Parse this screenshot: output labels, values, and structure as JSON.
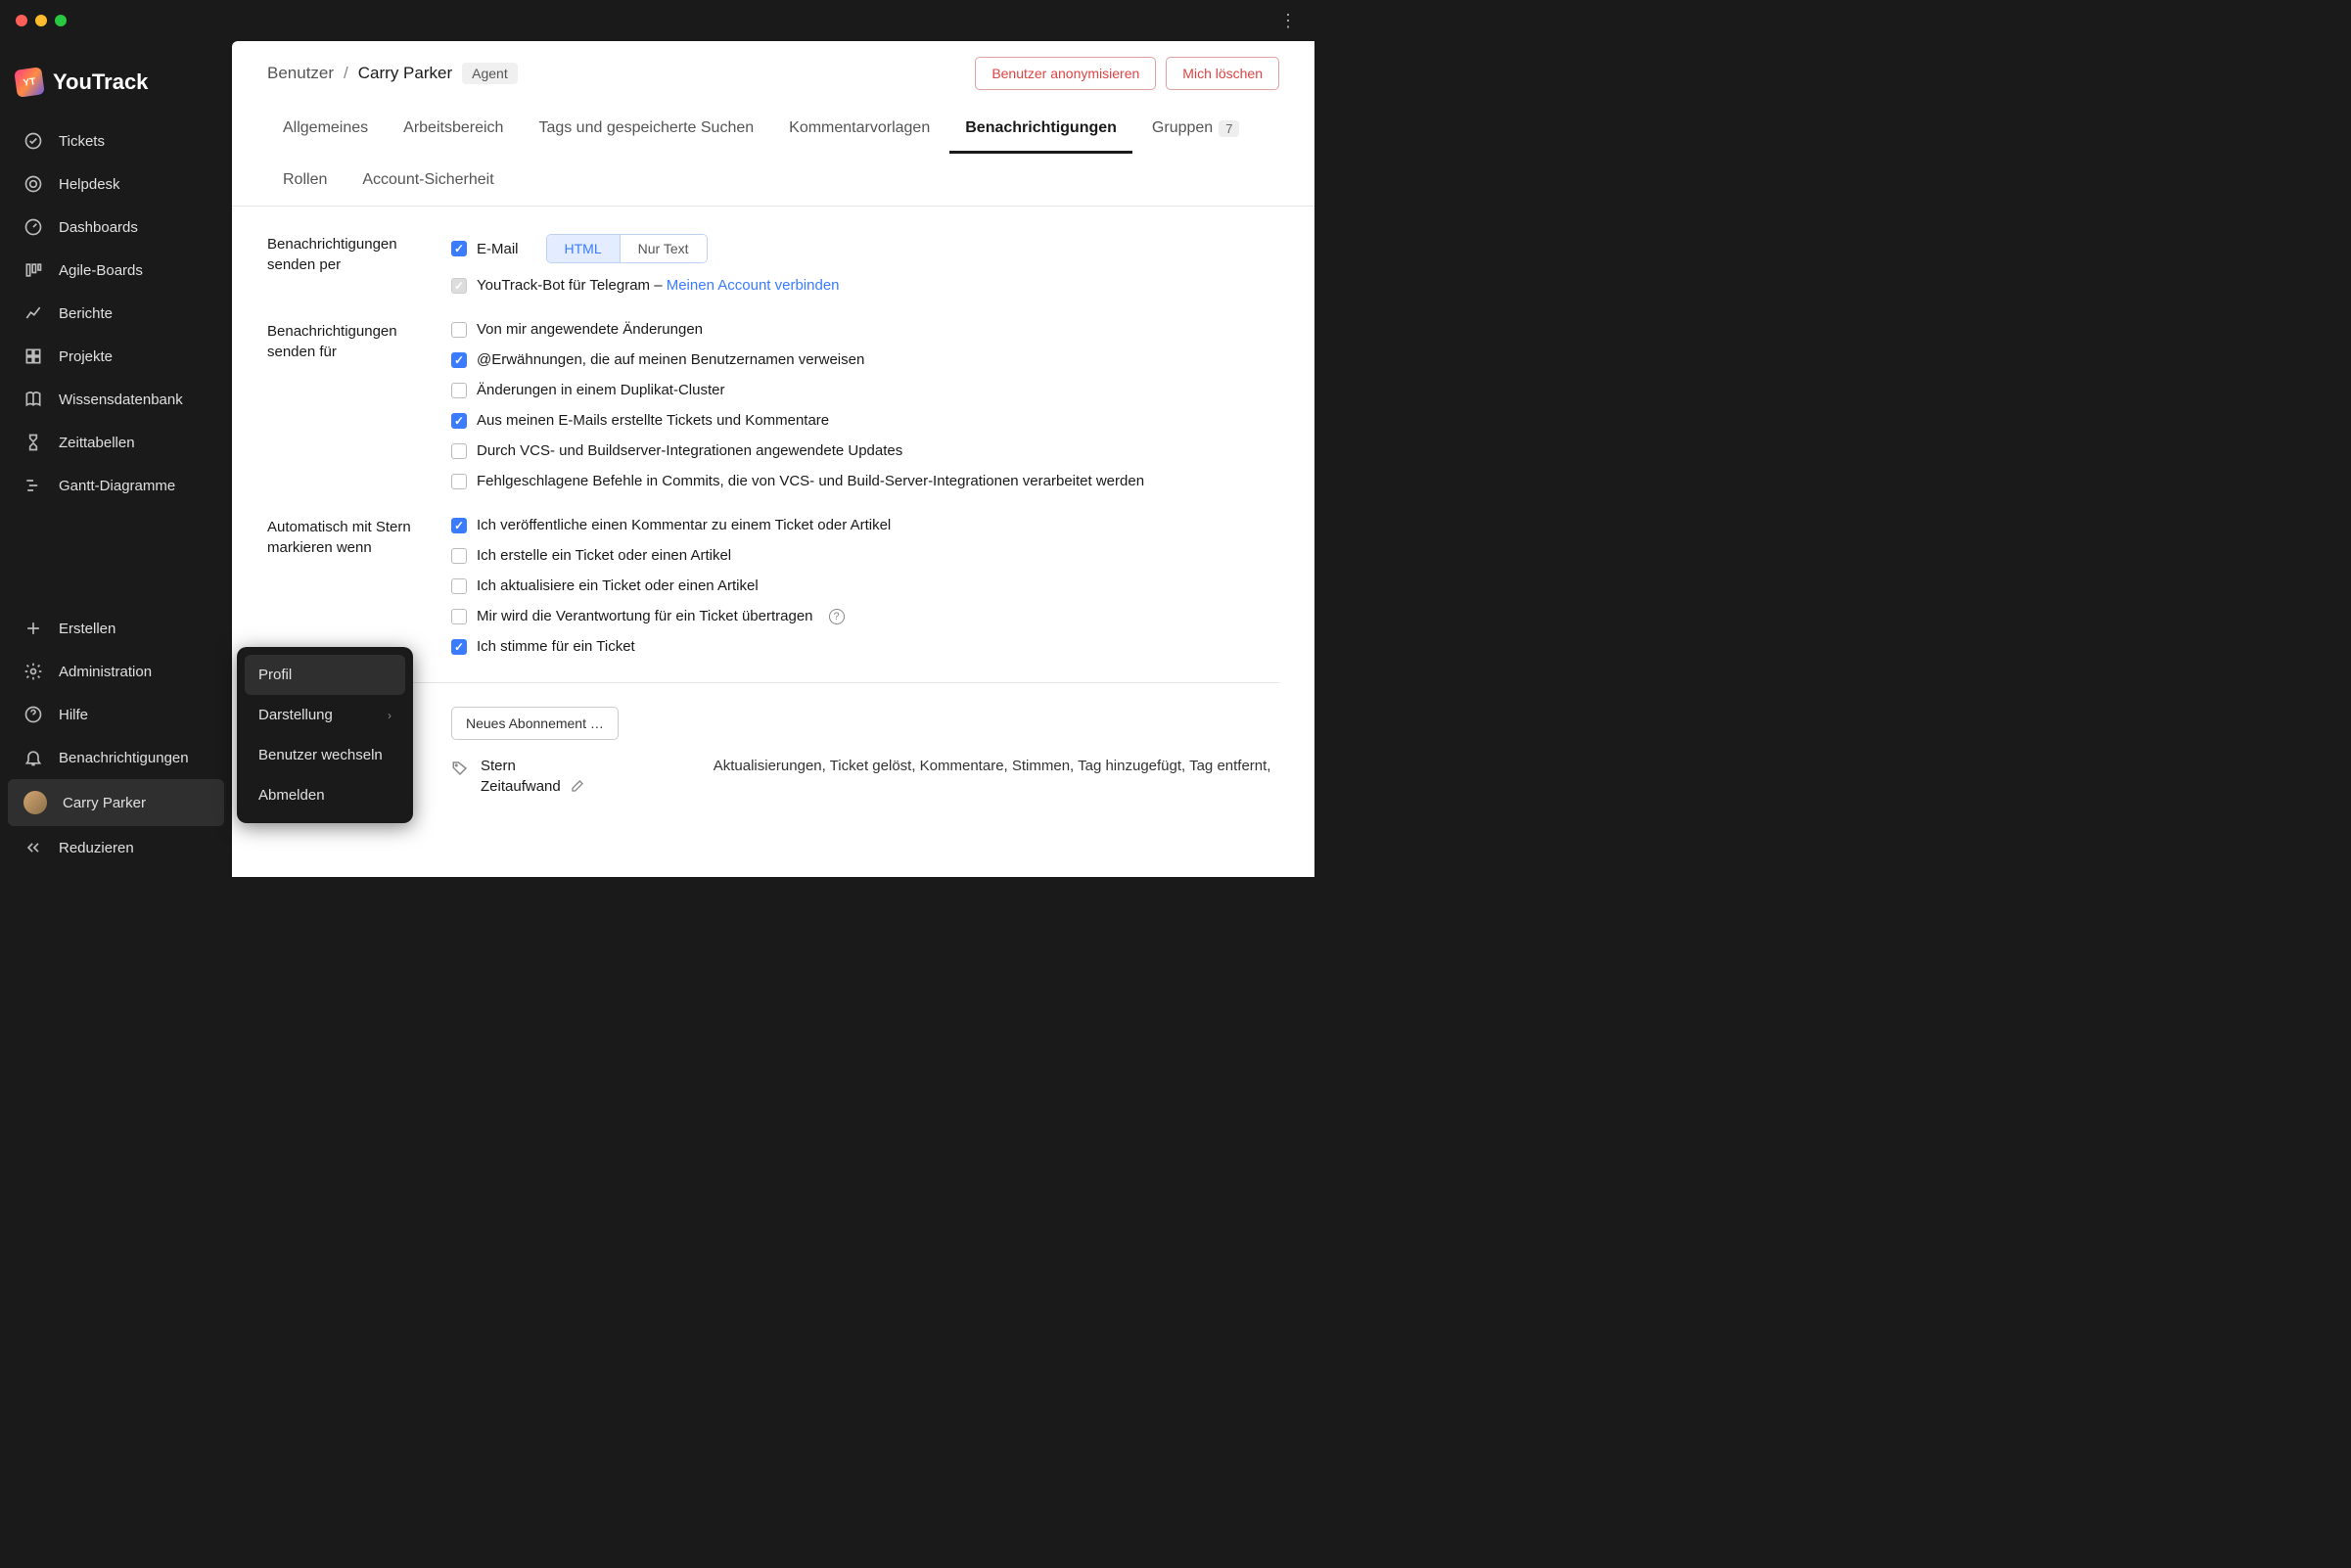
{
  "app": {
    "name": "YouTrack",
    "logoBadge": "YT"
  },
  "sidebar": {
    "items": [
      {
        "label": "Tickets"
      },
      {
        "label": "Helpdesk"
      },
      {
        "label": "Dashboards"
      },
      {
        "label": "Agile-Boards"
      },
      {
        "label": "Berichte"
      },
      {
        "label": "Projekte"
      },
      {
        "label": "Wissensdatenbank"
      },
      {
        "label": "Zeittabellen"
      },
      {
        "label": "Gantt-Diagramme"
      }
    ],
    "bottom": {
      "create": "Erstellen",
      "admin": "Administration",
      "help": "Hilfe",
      "notifications": "Benachrichtigungen",
      "user": "Carry Parker",
      "collapse": "Reduzieren"
    }
  },
  "popup": {
    "items": [
      "Profil",
      "Darstellung",
      "Benutzer wechseln",
      "Abmelden"
    ]
  },
  "breadcrumb": {
    "parent": "Benutzer",
    "current": "Carry Parker",
    "badge": "Agent"
  },
  "headerActions": {
    "anonymize": "Benutzer anonymisieren",
    "deleteMe": "Mich löschen"
  },
  "tabs": [
    {
      "label": "Allgemeines"
    },
    {
      "label": "Arbeitsbereich"
    },
    {
      "label": "Tags und gespeicherte Suchen"
    },
    {
      "label": "Kommentarvorlagen"
    },
    {
      "label": "Benachrichtigungen",
      "active": true
    },
    {
      "label": "Gruppen",
      "count": "7"
    },
    {
      "label": "Rollen"
    },
    {
      "label": "Account-Sicherheit"
    }
  ],
  "settings": {
    "sendVia": {
      "label": "Benachrichtigungen senden per",
      "email": "E-Mail",
      "htmlBtn": "HTML",
      "textBtn": "Nur Text",
      "telegram": "YouTrack-Bot für Telegram – ",
      "telegramLink": "Meinen Account verbinden"
    },
    "sendFor": {
      "label": "Benachrichtigungen senden für",
      "items": [
        {
          "checked": false,
          "label": "Von mir angewendete Änderungen"
        },
        {
          "checked": true,
          "label": "@Erwähnungen, die auf meinen Benutzernamen verweisen"
        },
        {
          "checked": false,
          "label": "Änderungen in einem Duplikat-Cluster"
        },
        {
          "checked": true,
          "label": "Aus meinen E-Mails erstellte Tickets und Kommentare"
        },
        {
          "checked": false,
          "label": "Durch VCS- und Buildserver-Integrationen angewendete Updates"
        },
        {
          "checked": false,
          "label": "Fehlgeschlagene Befehle in Commits, die von VCS- und Build-Server-Integrationen verarbeitet werden"
        }
      ]
    },
    "autoStar": {
      "label": "Automatisch mit Stern markieren wenn",
      "items": [
        {
          "checked": true,
          "label": "Ich veröffentliche einen Kommentar zu einem Ticket oder Artikel"
        },
        {
          "checked": false,
          "label": "Ich erstelle ein Ticket oder einen Artikel"
        },
        {
          "checked": false,
          "label": "Ich aktualisiere ein Ticket oder einen Artikel"
        },
        {
          "checked": false,
          "label": "Mir wird die Verantwortung für ein Ticket übertragen",
          "help": true
        },
        {
          "checked": true,
          "label": "Ich stimme für ein Ticket"
        }
      ]
    },
    "subscription": {
      "newBtn": "Neues Abonnement …",
      "starTitle": "Stern",
      "starSubtitle": "Zeitaufwand",
      "starDesc": "Aktualisierungen, Ticket gelöst, Kommentare, Stimmen, Tag hinzugefügt, Tag entfernt,"
    }
  }
}
